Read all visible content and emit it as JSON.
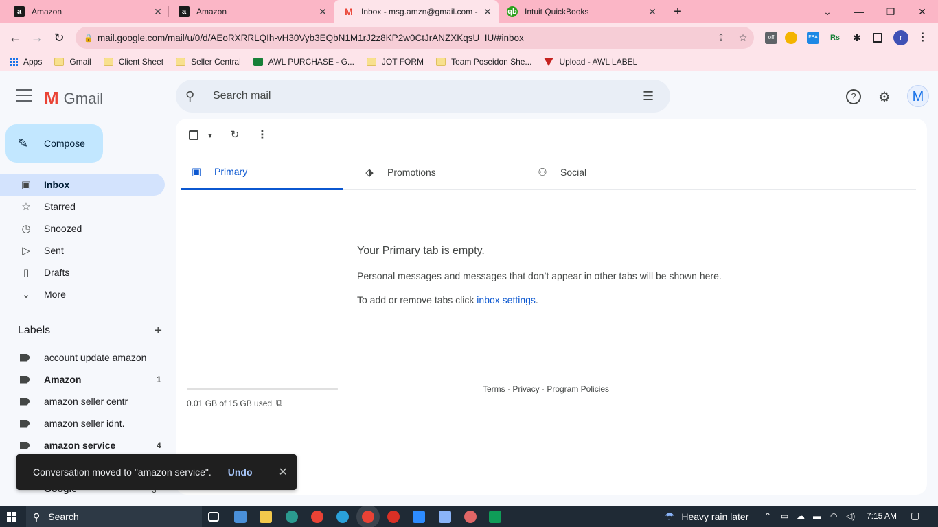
{
  "browser": {
    "tabs": [
      {
        "title": "Amazon",
        "favicon": "amazon-favicon",
        "active": false
      },
      {
        "title": "Amazon",
        "favicon": "amazon-favicon",
        "active": false
      },
      {
        "title": "Inbox - msg.amzn@gmail.com -",
        "favicon": "gmail-favicon",
        "active": true
      },
      {
        "title": "Intuit QuickBooks",
        "favicon": "quickbooks-favicon",
        "active": false
      }
    ],
    "url": "mail.google.com/mail/u/0/d/AEoRXRRLQIh-vH30Vyb3EQbN1M1rJ2z8KP2w0CtJrANZXKqsU_IU/#inbox",
    "profile_initial": "r",
    "bookmarks": [
      {
        "label": "Apps",
        "icon": "apps-grid-icon"
      },
      {
        "label": "Gmail",
        "icon": "folder-icon"
      },
      {
        "label": "Client Sheet",
        "icon": "folder-icon"
      },
      {
        "label": "Seller Central",
        "icon": "folder-icon"
      },
      {
        "label": "AWL PURCHASE - G...",
        "icon": "sheets-icon"
      },
      {
        "label": "JOT FORM",
        "icon": "folder-icon"
      },
      {
        "label": "Team Poseidon She...",
        "icon": "folder-icon"
      },
      {
        "label": "Upload - AWL LABEL",
        "icon": "triangle-icon"
      }
    ]
  },
  "gmail": {
    "app_name": "Gmail",
    "search_placeholder": "Search mail",
    "account_initial": "M",
    "compose_label": "Compose",
    "nav": [
      {
        "label": "Inbox",
        "icon": "inbox-icon",
        "selected": true
      },
      {
        "label": "Starred",
        "icon": "star-icon",
        "selected": false
      },
      {
        "label": "Snoozed",
        "icon": "clock-icon",
        "selected": false
      },
      {
        "label": "Sent",
        "icon": "send-icon",
        "selected": false
      },
      {
        "label": "Drafts",
        "icon": "draft-icon",
        "selected": false
      },
      {
        "label": "More",
        "icon": "chevron-down-icon",
        "selected": false
      }
    ],
    "labels_heading": "Labels",
    "labels": [
      {
        "name": "account update amazon",
        "count": "",
        "bold": false
      },
      {
        "name": "Amazon",
        "count": "1",
        "bold": true
      },
      {
        "name": "amazon seller centr",
        "count": "",
        "bold": false
      },
      {
        "name": "amazon seller idnt.",
        "count": "",
        "bold": false
      },
      {
        "name": "amazon service",
        "count": "4",
        "bold": true
      }
    ],
    "partially_hidden_label": {
      "name": "Google",
      "count": "3"
    },
    "tabs": [
      {
        "label": "Primary",
        "icon": "inbox-tab-icon",
        "selected": true
      },
      {
        "label": "Promotions",
        "icon": "tag-icon",
        "selected": false
      },
      {
        "label": "Social",
        "icon": "people-icon",
        "selected": false
      }
    ],
    "empty_title": "Your Primary tab is empty.",
    "empty_message": "Personal messages and messages that don’t appear in other tabs will be shown here.",
    "empty_settings_prefix": "To add or remove tabs click ",
    "empty_settings_link": "inbox settings",
    "empty_settings_suffix": ".",
    "storage_used": "0.01 GB of 15 GB used",
    "storage_fraction": 0.0007,
    "footer": "Terms · Privacy · Program Policies",
    "snackbar": {
      "message": "Conversation moved to \"amazon service\".",
      "undo": "Undo"
    }
  },
  "taskbar": {
    "search_label": "Search",
    "weather": "Heavy rain later",
    "time": "7:15 AM"
  },
  "colors": {
    "tab_strip": "#fbb6c6",
    "toolbar": "#fde4ea",
    "compose": "#c2e7ff",
    "selected_nav": "#d3e3fd",
    "accent": "#0b57d0"
  }
}
